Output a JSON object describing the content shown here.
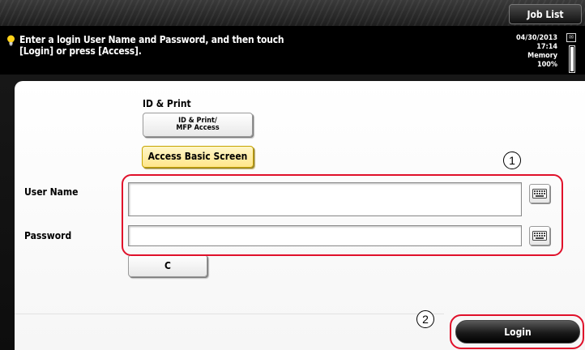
{
  "header": {
    "job_list_label": "Job List"
  },
  "message_bar": {
    "line1": "Enter a login User Name and Password, and then touch",
    "line2": "[Login] or press [Access].",
    "icon": "lightbulb-icon"
  },
  "status": {
    "date": "04/30/2013",
    "time": "17:14",
    "memory_label": "Memory",
    "memory_percent": "100%",
    "memory_level": 1.0
  },
  "auth_mode": {
    "section_label": "ID & Print",
    "idp_button_line1": "ID & Print/",
    "idp_button_line2": "MFP Access",
    "basic_screen_button": "Access Basic Screen"
  },
  "form": {
    "user_name_label": "User Name",
    "user_name_value": "",
    "password_label": "Password",
    "password_value": "",
    "keyboard_icon": "keyboard-icon",
    "clear_button": "C"
  },
  "callouts": {
    "one": "1",
    "two": "2"
  },
  "actions": {
    "login_button": "Login"
  },
  "colors": {
    "highlight": "#e0102a",
    "basic_screen_button": "#ffe68a"
  }
}
